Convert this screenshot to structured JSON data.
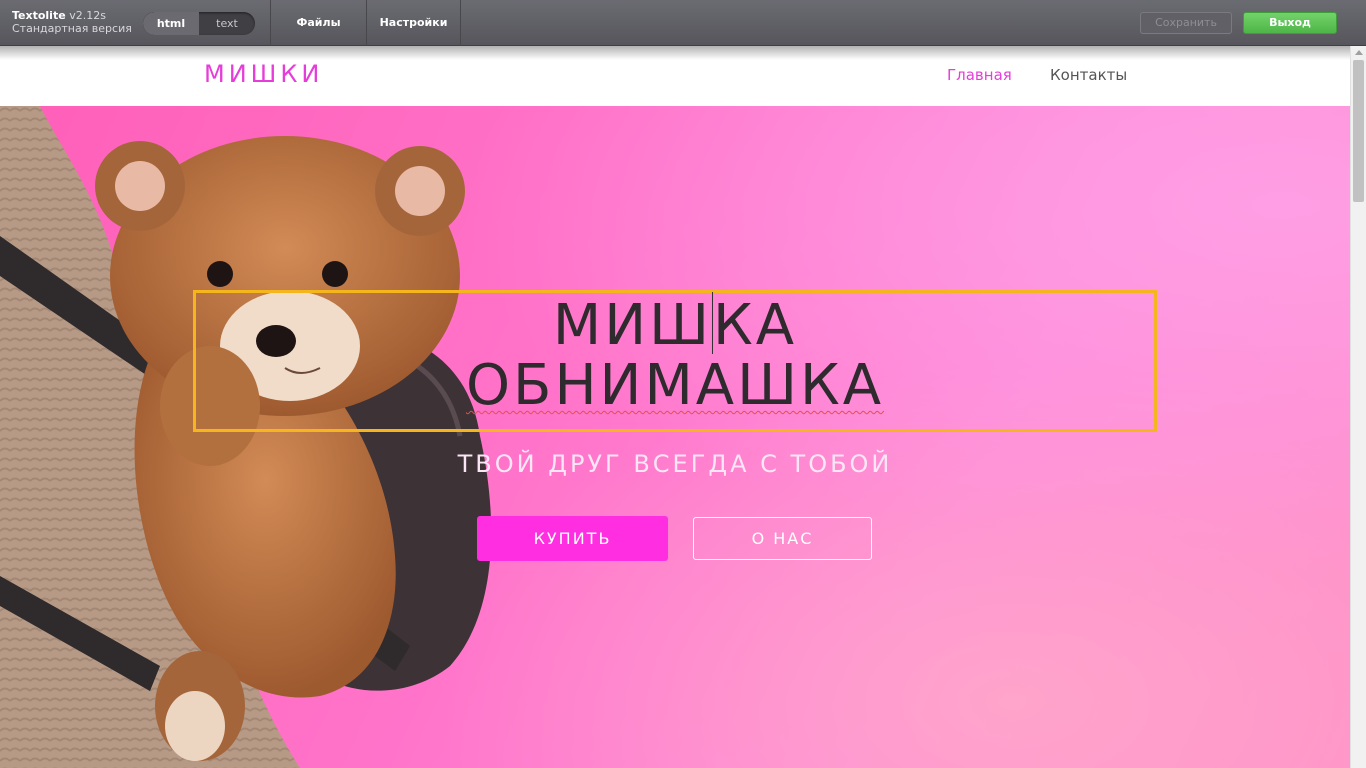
{
  "editor": {
    "app_name": "Textolite",
    "version": "v2.12s",
    "edition": "Стандартная версия",
    "mode_html": "html",
    "mode_text": "text",
    "menu_files": "Файлы",
    "menu_settings": "Настройки",
    "save_label": "Сохранить",
    "exit_label": "Выход",
    "exit_color": "#5cc454"
  },
  "site": {
    "logo": "МИШКИ",
    "nav": {
      "home": "Главная",
      "contacts": "Контакты"
    },
    "accent": "#e63cd9"
  },
  "hero": {
    "headline_line1": "МИШКА",
    "headline_line2": "ОБНИМАШКА",
    "tagline": "ТВОЙ ДРУГ ВСЕГДА С ТОБОЙ",
    "buy_label": "КУПИТЬ",
    "about_label": "О НАС",
    "selection_color": "#f4b51d",
    "buy_color": "#ff2ee0",
    "illustration": "teddy-bear-backpack"
  }
}
